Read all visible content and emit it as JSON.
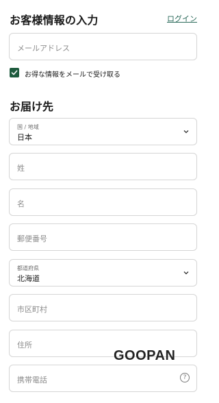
{
  "header": {
    "title": "お客様情報の入力",
    "login_link": "ログイン"
  },
  "contact": {
    "email_placeholder": "メールアドレス",
    "newsletter_label": "お得な情報をメールで受け取る",
    "newsletter_checked": true
  },
  "shipping": {
    "title": "お届け先",
    "country_label": "国 / 地域",
    "country_value": "日本",
    "last_name_placeholder": "姓",
    "first_name_placeholder": "名",
    "postal_placeholder": "郵便番号",
    "prefecture_label": "都道府県",
    "prefecture_value": "北海道",
    "city_placeholder": "市区町村",
    "address_placeholder": "住所",
    "phone_placeholder": "携帯電話"
  },
  "icons": {
    "help": "help-circle-icon",
    "chevron": "chevron-down-icon",
    "check": "check-icon"
  },
  "colors": {
    "accent": "#1e5b3e",
    "link": "#2b6a5a"
  },
  "watermark": "GOOPAN"
}
